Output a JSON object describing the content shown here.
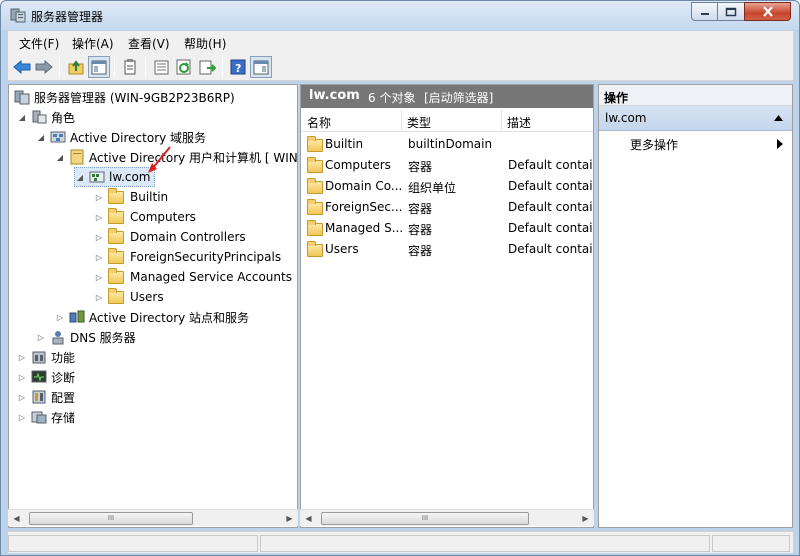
{
  "window": {
    "title": "服务器管理器"
  },
  "menu": [
    "文件(F)",
    "操作(A)",
    "查看(V)",
    "帮助(H)"
  ],
  "toolbar": {
    "icons": [
      "back-arrow-icon",
      "forward-arrow-icon",
      "up-folder-icon",
      "show-tree-icon",
      "properties-icon",
      "export-icon",
      "refresh-icon",
      "export-list-icon",
      "help-icon",
      "show-hide-action-pane-icon"
    ]
  },
  "tree": {
    "root": "服务器管理器 (WIN-9GB2P23B6RP)",
    "roles": "角色",
    "ad_ds": "Active Directory 域服务",
    "ad_uc": "Active Directory 用户和计算机 [ WIN",
    "domain": "lw.com",
    "children": [
      "Builtin",
      "Computers",
      "Domain Controllers",
      "ForeignSecurityPrincipals",
      "Managed Service Accounts",
      "Users"
    ],
    "ad_sites": "Active Directory 站点和服务",
    "dns": "DNS 服务器",
    "features": "功能",
    "diagnostics": "诊断",
    "configuration": "配置",
    "storage": "存储"
  },
  "middle": {
    "title": "lw.com",
    "count": "6 个对象",
    "filter": "[启动筛选器]",
    "columns": [
      "名称",
      "类型",
      "描述"
    ],
    "rows": [
      {
        "name": "Builtin",
        "type": "builtinDomain",
        "desc": ""
      },
      {
        "name": "Computers",
        "type": "容器",
        "desc": "Default contair"
      },
      {
        "name": "Domain Co...",
        "type": "组织单位",
        "desc": "Default contair"
      },
      {
        "name": "ForeignSec...",
        "type": "容器",
        "desc": "Default contair"
      },
      {
        "name": "Managed S...",
        "type": "容器",
        "desc": "Default contair"
      },
      {
        "name": "Users",
        "type": "容器",
        "desc": "Default contair"
      }
    ]
  },
  "actions": {
    "header": "操作",
    "section": "lw.com",
    "more": "更多操作"
  },
  "scroll_thumb": "III"
}
